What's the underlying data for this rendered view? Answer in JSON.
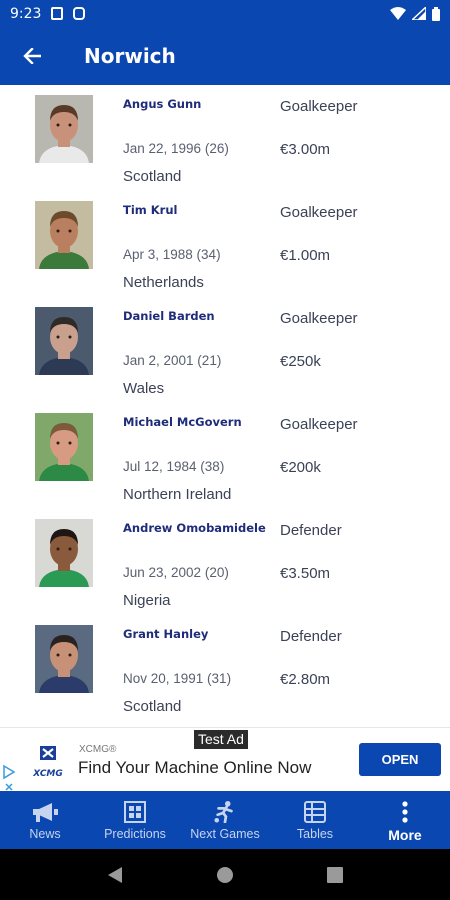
{
  "status_bar": {
    "time": "9:23"
  },
  "header": {
    "title": "Norwich"
  },
  "players": [
    {
      "name": "Angus Gunn",
      "dob": "Jan 22, 1996 (26)",
      "country": "Scotland",
      "position": "Goalkeeper",
      "value": "€3.00m",
      "skin": "#c8927a",
      "hair": "#5a3a26",
      "shirt": "#e9e9e9",
      "bg": "#b8b8b0"
    },
    {
      "name": "Tim Krul",
      "dob": "Apr 3, 1988 (34)",
      "country": "Netherlands",
      "position": "Goalkeeper",
      "value": "€1.00m",
      "skin": "#b97f60",
      "hair": "#6b4b2a",
      "shirt": "#3c7a3c",
      "bg": "#c4bca0"
    },
    {
      "name": "Daniel Barden",
      "dob": "Jan 2, 2001 (21)",
      "country": "Wales",
      "position": "Goalkeeper",
      "value": "€250k",
      "skin": "#c9a08e",
      "hair": "#2e2a28",
      "shirt": "#2d3a55",
      "bg": "#4c5a6e"
    },
    {
      "name": "Michael McGovern",
      "dob": "Jul 12, 1984 (38)",
      "country": "Northern Ireland",
      "position": "Goalkeeper",
      "value": "€200k",
      "skin": "#d69b82",
      "hair": "#7b5b3a",
      "shirt": "#2d8a46",
      "bg": "#7fa86a"
    },
    {
      "name": "Andrew Omobamidele",
      "dob": "Jun 23, 2002 (20)",
      "country": "Nigeria",
      "position": "Defender",
      "value": "€3.50m",
      "skin": "#8a5a3c",
      "hair": "#1e1612",
      "shirt": "#2a9a55",
      "bg": "#d8d8d4"
    },
    {
      "name": "Grant Hanley",
      "dob": "Nov 20, 1991 (31)",
      "country": "Scotland",
      "position": "Defender",
      "value": "€2.80m",
      "skin": "#c79178",
      "hair": "#2a2220",
      "shirt": "#2b3c6a",
      "bg": "#5a6a80"
    }
  ],
  "ad": {
    "label": "Test Ad",
    "brand": "XCMG®",
    "logo_text": "XCMG",
    "headline": "Find Your Machine Online Now",
    "cta": "OPEN"
  },
  "bottom_nav": [
    {
      "label": "News",
      "icon": "megaphone-icon"
    },
    {
      "label": "Predictions",
      "icon": "grid-icon"
    },
    {
      "label": "Next Games",
      "icon": "player-kicking-icon"
    },
    {
      "label": "Tables",
      "icon": "table-icon"
    },
    {
      "label": "More",
      "icon": "more-vertical-icon",
      "active": true
    }
  ],
  "colors": {
    "primary": "#0a47b0",
    "name_text": "#1f2c7a",
    "body_text": "#3b4256"
  }
}
